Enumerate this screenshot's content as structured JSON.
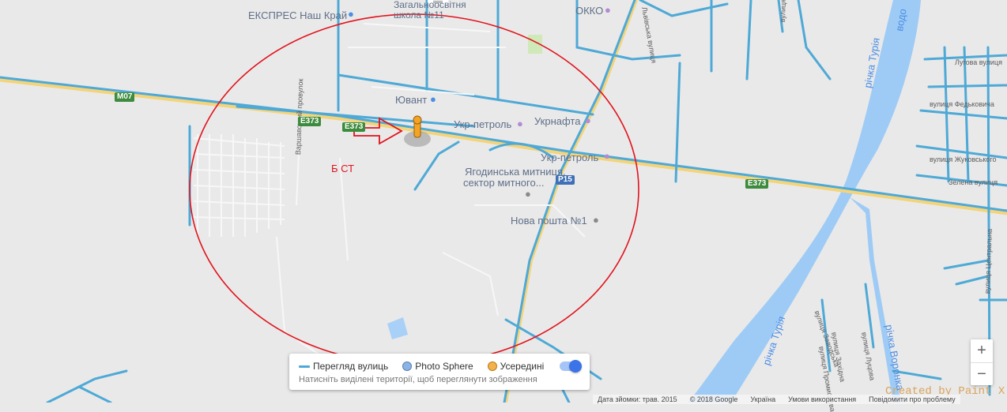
{
  "map": {
    "places": {
      "ekspres": "ЕКСПРЕС Наш Край",
      "school": "Загальноосвітня школа №11",
      "okko": "ОККО",
      "yuvant": "Ювант",
      "ukrpetrol1": "Укр-петроль",
      "ukrnafta": "Укрнафта",
      "ukrpetrol2": "Укр-петроль",
      "customs_line1": "Ягодинська митниця,",
      "customs_line2": "сектор митного...",
      "nova_poshta": "Нова пошта №1",
      "annotation": "Б СТ"
    },
    "streets": {
      "lvivska": "Львівська вулиця",
      "varshavskyi": "Варшавський провулок",
      "luhova": "Лугова вулиця",
      "fedkovycha": "вулиця Федьковича",
      "zhukovskoho": "вулиця Жуковського",
      "zelena": "Зелена вулиця",
      "tsentralna": "вулиця Центральна",
      "vulytsia_top": "вулиця",
      "lutsova": "вулиця Луцова",
      "zakhidna": "вулиця Західна",
      "promyslova": "вулиця Промислова",
      "zavodska": "вулиця Заводська"
    },
    "water": {
      "turia_top": "річка Турія",
      "vodo": "водо",
      "turia_bottom": "річка Турія",
      "voronka": "річка Воронка"
    },
    "roads": {
      "m07": "M07",
      "e373_a": "E373",
      "e373_b": "E373",
      "e373_c": "E373",
      "p15": "P15"
    },
    "colors": {
      "street_view": "#4ea9d6",
      "circle": "#e2121c",
      "water": "#9ecbf5",
      "road": "#f4d47a",
      "pegman": "#f3a423"
    }
  },
  "legend": {
    "street_view": "Перегляд вулиць",
    "photo_sphere": "Photo Sphere",
    "indoor": "Усередині",
    "hint": "Натисніть виділені території, щоб переглянути зображення"
  },
  "zoom": {
    "plus": "+",
    "minus": "−"
  },
  "footer": {
    "date": "Дата зйомки: трав. 2015",
    "copyright": "© 2018 Google",
    "country": "Україна",
    "terms": "Умови використання",
    "report": "Повідомити про проблему"
  },
  "watermark": "Created by Paint X"
}
